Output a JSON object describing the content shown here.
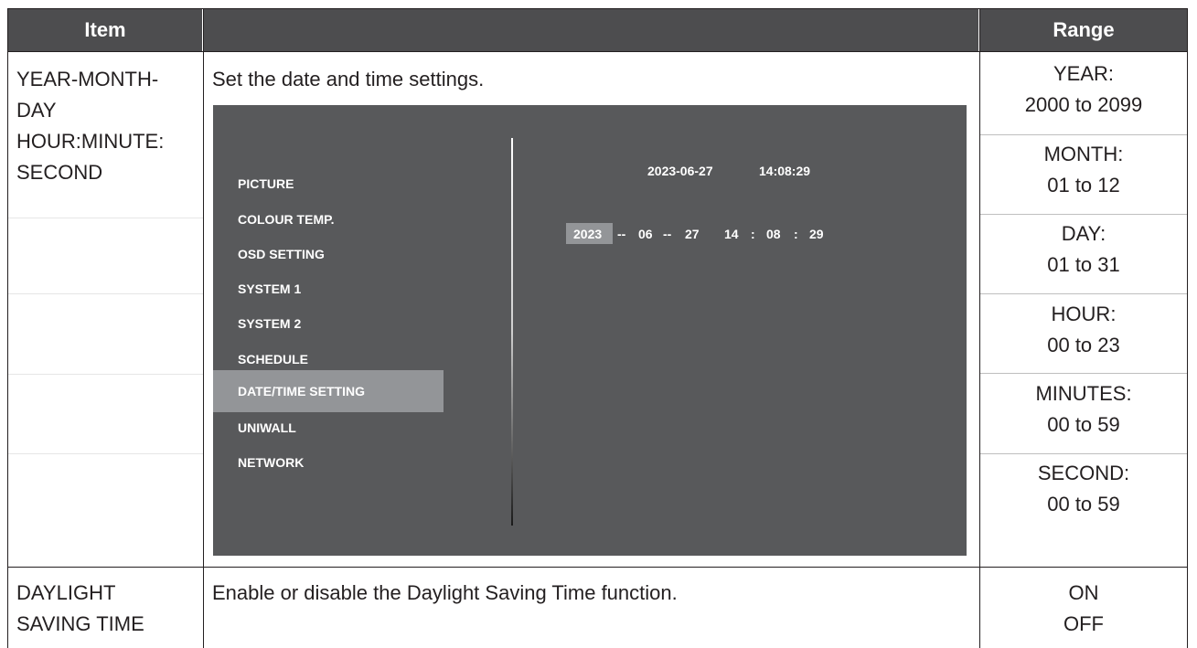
{
  "table": {
    "headers": [
      "Item",
      "",
      "Range"
    ],
    "rows": [
      {
        "item": [
          "YEAR-MONTH-",
          "DAY",
          "HOUR:MINUTE:",
          "SECOND"
        ],
        "description": "Set the date and time settings.",
        "ranges": [
          [
            "YEAR:",
            "2000 to 2099"
          ],
          [
            "MONTH:",
            "01 to 12"
          ],
          [
            "DAY:",
            "01 to 31"
          ],
          [
            "HOUR:",
            "00 to 23"
          ],
          [
            "MINUTES:",
            "00 to 59"
          ],
          [
            "SECOND:",
            "00 to 59"
          ]
        ]
      },
      {
        "item": [
          "DAYLIGHT",
          "SAVING TIME"
        ],
        "description": "Enable or disable the Daylight Saving Time function.",
        "ranges": [
          [
            "ON",
            "OFF"
          ]
        ]
      }
    ]
  },
  "osd": {
    "menu": [
      "PICTURE",
      "COLOUR TEMP.",
      "OSD SETTING",
      "SYSTEM 1",
      "SYSTEM 2",
      "SCHEDULE",
      "DATE/TIME SETTING",
      "UNIWALL",
      "NETWORK"
    ],
    "selected_index": 6,
    "current_date": "2023-06-27",
    "current_time": "14:08:29",
    "edit": {
      "year": "2023",
      "sep1": "--",
      "month": "06",
      "sep2": "--",
      "day": "27",
      "hour": "14",
      "colon1": ":",
      "minute": "08",
      "colon2": ":",
      "second": "29"
    }
  },
  "colors": {
    "header_bg": "#4d4d4f",
    "osd_bg": "#58595b",
    "osd_selected": "#939598"
  }
}
